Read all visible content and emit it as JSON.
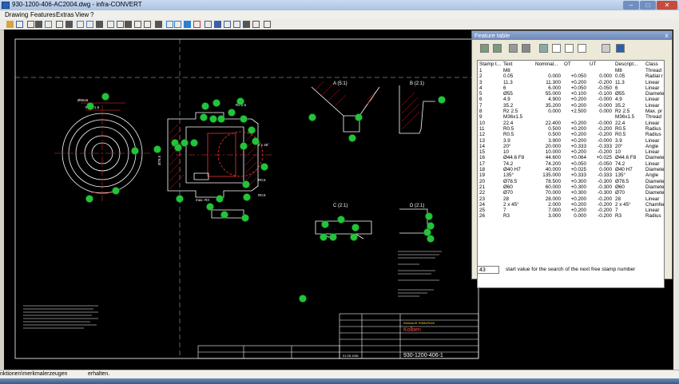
{
  "window": {
    "title": "930-1200-406-AC2004.dwg - infra-CONVERT",
    "minimize_label": "–",
    "maximize_label": "□",
    "close_label": "✕"
  },
  "menu": [
    "Drawing",
    "Features",
    "Extras",
    "View",
    "?"
  ],
  "toolbar_icons": [
    "open-icon",
    "save-icon",
    "layers-icon",
    "grid-icon",
    "tree-icon",
    "pen-icon",
    "table-icon",
    "list-icon",
    "dimension-icon",
    "measure-icon",
    "zoom-icon",
    "stamp-icon",
    "stamp-auto-icon",
    "renumber-icon",
    "find-icon",
    "settings-icon",
    "copy-icon",
    "paste-icon",
    "export-icon",
    "delete-icon",
    "zoom-in-icon",
    "zoom-out-icon",
    "zoom-all-icon",
    "zoom-window-icon",
    "view-icon",
    "pan-icon",
    "help-icon"
  ],
  "feature_table": {
    "title": "Feature table",
    "close_label": "x",
    "tool_icons": [
      "move-up-icon",
      "move-down-icon",
      "grid-view-icon",
      "delete-icon",
      "copy-icon",
      "table-icon",
      "export-icon",
      "settings-icon",
      "print-icon",
      "excel-icon"
    ],
    "columns": [
      "Stamp t...",
      "Text",
      "Nominal...",
      "OT",
      "UT",
      "Descript...",
      "Class"
    ],
    "rows": [
      [
        "1",
        "M8",
        "",
        "",
        "",
        "M8",
        "Thread"
      ],
      [
        "2",
        "0.05",
        "0.000",
        "+0.050",
        "0.000",
        "0.05",
        "Radial r"
      ],
      [
        "3",
        "11.3",
        "11.300",
        "+0.200",
        "-0.200",
        "11.3",
        "Linear"
      ],
      [
        "4",
        "6",
        "6.000",
        "+0.050",
        "-0.050",
        "6",
        "Linear"
      ],
      [
        "5",
        "Ø55",
        "55.000",
        "+0.100",
        "-0.100",
        "Ø55",
        "Diameter"
      ],
      [
        "6",
        "4.9",
        "4.900",
        "+0.200",
        "-0.000",
        "4.9",
        "Linear"
      ],
      [
        "7",
        "35.2",
        "35.200",
        "+0.200",
        "-0.000",
        "35.2",
        "Linear"
      ],
      [
        "8",
        "Rz 2.5",
        "0.000",
        "+2.500",
        "0.000",
        "Rz 2.5",
        "Max. pr"
      ],
      [
        "9",
        "M36x1.5",
        "",
        "",
        "",
        "M36x1.5",
        "Thread"
      ],
      [
        "10",
        "22.4",
        "22.400",
        "+0.200",
        "-0.000",
        "22.4",
        "Linear"
      ],
      [
        "11",
        "R0.5",
        "0.500",
        "+0.200",
        "-0.200",
        "R0.5",
        "Radius"
      ],
      [
        "12",
        "R0.5",
        "0.500",
        "+0.200",
        "-0.200",
        "R0.5",
        "Radius"
      ],
      [
        "13",
        "3.9",
        "3.900",
        "+0.200",
        "-0.000",
        "3.9",
        "Linear"
      ],
      [
        "14",
        "20°",
        "20.000",
        "+0.333",
        "-0.333",
        "20°",
        "Angle"
      ],
      [
        "15",
        "10",
        "10.000",
        "+0.200",
        "-0.200",
        "10",
        "Linear"
      ],
      [
        "16",
        "Ø44.6 F8",
        "44.600",
        "+0.064",
        "+0.025",
        "Ø44.6 F8",
        "Diameter"
      ],
      [
        "17",
        "74.2",
        "74.200",
        "+0.050",
        "-0.050",
        "74.2",
        "Linear"
      ],
      [
        "18",
        "Ø40 H7",
        "40.000",
        "+0.025",
        "0.000",
        "Ø40 H7",
        "Diameter"
      ],
      [
        "19",
        "135°",
        "135.000",
        "+0.333",
        "-0.333",
        "135°",
        "Angle"
      ],
      [
        "20",
        "Ø78.5",
        "78.500",
        "+0.300",
        "-0.300",
        "Ø78.5",
        "Diameter"
      ],
      [
        "21",
        "Ø60",
        "60.000",
        "+0.300",
        "-0.300",
        "Ø60",
        "Diameter"
      ],
      [
        "22",
        "Ø70",
        "70.000",
        "+0.300",
        "-0.300",
        "Ø70",
        "Diameter"
      ],
      [
        "23",
        "28",
        "28.000",
        "+0.200",
        "-0.200",
        "28",
        "Linear"
      ],
      [
        "24",
        "2 x 45°",
        "2.000",
        "+0.200",
        "-0.200",
        "2 x 45°",
        "Chamfer"
      ],
      [
        "25",
        "7",
        "7.000",
        "+0.200",
        "-0.200",
        "7",
        "Linear"
      ],
      [
        "26",
        "R3",
        "3.000",
        "0.000",
        "-0.200",
        "R3",
        "Radius"
      ]
    ],
    "start_value": "43",
    "start_hint": "start value for the search of the next free stamp number"
  },
  "drawing": {
    "views": {
      "a": "A (5:1)",
      "b": "B (2:1)",
      "c": "C (2:1)",
      "d": "D (2:1)"
    },
    "title_block": {
      "part_name": "Kolben",
      "drawing_number": "930-1200-406-1",
      "material_label": "Werkstoff: 9SMnPb28",
      "date": "01.05.1961"
    },
    "dims": {
      "d1": "Ø55x6",
      "d2": "M36x1.5",
      "d3": "Rz 2.5",
      "d4": "Ø78.5",
      "d5": "R0.5",
      "d6": "2 x 45°",
      "d7": "R0.5",
      "d8": "max. R3"
    }
  },
  "status": {
    "text": "nktionen\\merkmalerzeugen",
    "text2": "erhalten."
  },
  "colors": {
    "canvas": "#000000",
    "drawing_lines": "#ffffff",
    "dimension_lines": "#ff0000",
    "stamps": "#23c43a",
    "highlight": "#ff2020"
  }
}
